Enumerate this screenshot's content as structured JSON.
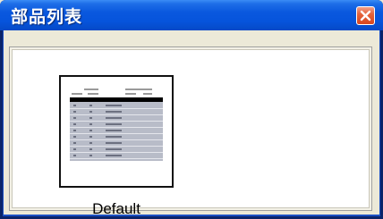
{
  "window": {
    "title": "部品列表"
  },
  "parts": [
    {
      "label": "Default"
    }
  ],
  "icons": {
    "close": "close-icon",
    "thumbnail": "table-preview-icon"
  },
  "colors": {
    "titlebar": "#0a58de",
    "close": "#d8461e",
    "body": "#ece9d8"
  }
}
